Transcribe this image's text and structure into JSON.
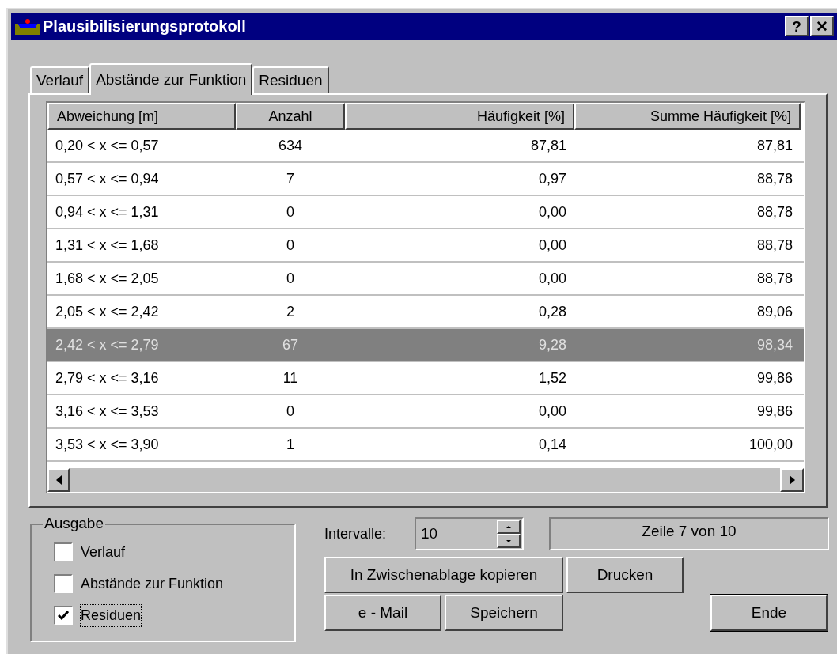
{
  "window": {
    "title": "Plausibilisierungsprotokoll",
    "help_button": "?",
    "close_button": "✕"
  },
  "tabs": [
    {
      "label": "Verlauf",
      "selected": false
    },
    {
      "label": "Abstände zur Funktion",
      "selected": true
    },
    {
      "label": "Residuen",
      "selected": false
    }
  ],
  "table": {
    "columns": [
      "Abweichung [m]",
      "Anzahl",
      "Häufigkeit [%]",
      "Summe Häufigkeit [%]"
    ],
    "rows": [
      {
        "cells": [
          "0,20 < x <= 0,57",
          "634",
          "87,81",
          "87,81"
        ],
        "selected": false
      },
      {
        "cells": [
          "0,57 < x <= 0,94",
          "7",
          "0,97",
          "88,78"
        ],
        "selected": false
      },
      {
        "cells": [
          "0,94 < x <= 1,31",
          "0",
          "0,00",
          "88,78"
        ],
        "selected": false
      },
      {
        "cells": [
          "1,31 < x <= 1,68",
          "0",
          "0,00",
          "88,78"
        ],
        "selected": false
      },
      {
        "cells": [
          "1,68 < x <= 2,05",
          "0",
          "0,00",
          "88,78"
        ],
        "selected": false
      },
      {
        "cells": [
          "2,05 < x <= 2,42",
          "2",
          "0,28",
          "89,06"
        ],
        "selected": false
      },
      {
        "cells": [
          "2,42 < x <= 2,79",
          "67",
          "9,28",
          "98,34"
        ],
        "selected": true
      },
      {
        "cells": [
          "2,79 < x <= 3,16",
          "11",
          "1,52",
          "99,86"
        ],
        "selected": false
      },
      {
        "cells": [
          "3,16 < x <= 3,53",
          "0",
          "0,00",
          "99,86"
        ],
        "selected": false
      },
      {
        "cells": [
          "3,53 < x <= 3,90",
          "1",
          "0,14",
          "100,00"
        ],
        "selected": false
      }
    ]
  },
  "output_group": {
    "title": "Ausgabe",
    "options": [
      {
        "label": "Verlauf",
        "checked": false,
        "focused": false
      },
      {
        "label": "Abstände zur Funktion",
        "checked": false,
        "focused": false
      },
      {
        "label": "Residuen",
        "checked": true,
        "focused": true
      }
    ]
  },
  "intervals": {
    "label": "Intervalle:",
    "value": "10"
  },
  "status": "Zeile 7 von 10",
  "buttons": [
    {
      "label": "In Zwischenablage kopieren",
      "default": false
    },
    {
      "label": "Drucken",
      "default": false
    },
    {
      "label": "e - Mail",
      "default": false
    },
    {
      "label": "Speichern",
      "default": false
    },
    {
      "label": "Ende",
      "default": true
    }
  ]
}
